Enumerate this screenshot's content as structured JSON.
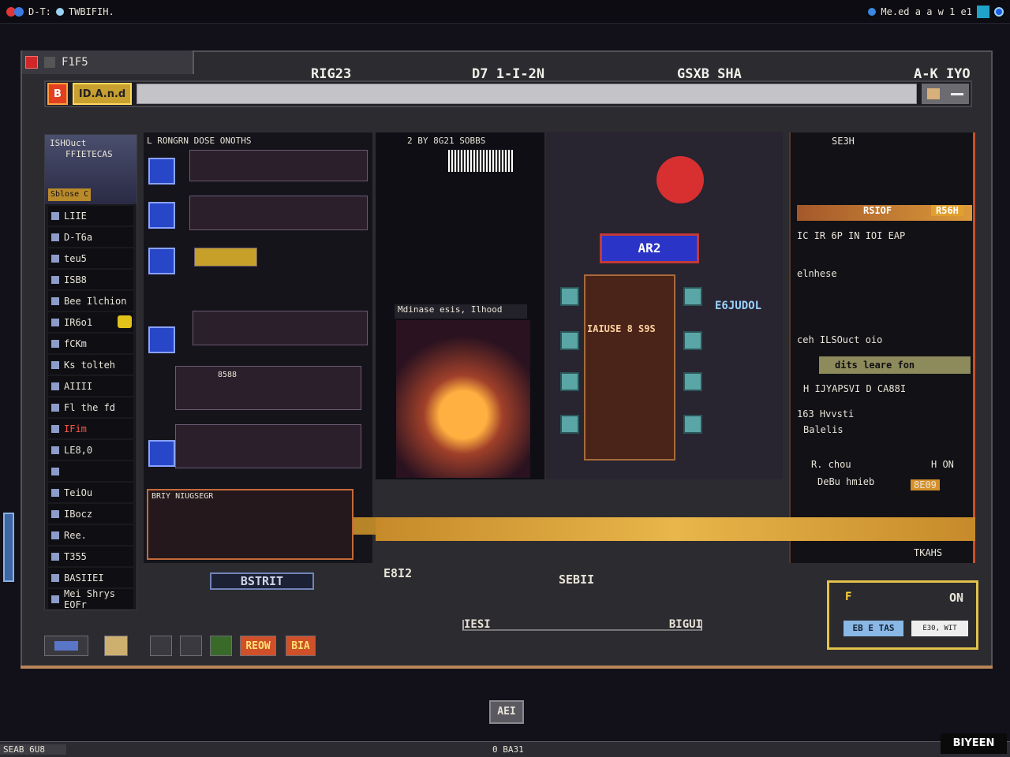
{
  "topbar": {
    "app_label": "D-T: ",
    "app_title": "TWBIFIH.",
    "right_text": "Me.ed  a  a  w  1 e1"
  },
  "window": {
    "tab_title": "F1F5",
    "toolbar": {
      "btn1": "B",
      "btn2": "ID.A.n.d"
    }
  },
  "sidebar": {
    "header_line1": "ISHOuct",
    "header_line2": "FFIETECAS",
    "badge": "Sblose C",
    "items": [
      {
        "label": "LIIE"
      },
      {
        "label": "D-T6a"
      },
      {
        "label": "teu5"
      },
      {
        "label": "ISB8"
      },
      {
        "label": "Bee Ilchion"
      },
      {
        "label": "IR6o1"
      },
      {
        "label": "fCKm"
      },
      {
        "label": "Ks tolteh"
      },
      {
        "label": "AIIII"
      },
      {
        "label": "Fl the fd"
      },
      {
        "label": "IFim"
      },
      {
        "label": "LE8,0"
      },
      {
        "label": ""
      },
      {
        "label": "TeiOu"
      },
      {
        "label": "IBocz"
      },
      {
        "label": "Ree."
      },
      {
        "label": "T355"
      },
      {
        "label": "BASIIEI"
      },
      {
        "label": "Mei Shrys EOFr"
      }
    ]
  },
  "columns": {
    "col1_head": "RIG23",
    "col2_head": "D7 1-I-2N",
    "col3_head": "GSXB SHA",
    "col4_head": "A-K IYO"
  },
  "col1": {
    "title": "L RONGRN DOSE ONOTHS",
    "stage_label": "8588",
    "strip_title": "BRIY NIUGSEGR"
  },
  "col2": {
    "header": "2 BY 8G21 SOBBS",
    "scene_label": "Mdinase esis, Ilhood"
  },
  "col3": {
    "sign": "AR2",
    "shop_label": "IAIUSE 8 S9S",
    "side_label": "E6JUDOL"
  },
  "col4": {
    "top_label": "SE3H",
    "tag_left": "RSIOF",
    "tag_right": "R56H",
    "row1": "IC IR 6P IN IOI  EAP",
    "row2": "elnhese",
    "row3": "ceh ILSOuct oio",
    "btn1": "dits  leare fon",
    "row4": "H IJYAPSVI  D  CA88I",
    "row5": "163 Hvvsti",
    "row6": "Balelis",
    "row7": "R.  chou",
    "row8": "DeBu hmieb",
    "row9": "H ON",
    "tag2": "8E09",
    "footer": "TKAHS"
  },
  "stage_labels": {
    "a": "E8I2",
    "b": "SEBII",
    "c": "BSTRIT",
    "d": "IESI",
    "e": "BIGUI"
  },
  "bottom_bar": {
    "b1": "REOW",
    "b2": "BIA"
  },
  "popup": {
    "title": "F",
    "state": "ON",
    "btn1": "EB E TAS",
    "btn2": "E30, WIT"
  },
  "center_button": "AEI",
  "statusbar": {
    "left": "SEAB 6U8",
    "center": "0 BA31"
  },
  "watermark": "BIYEEN",
  "colors": {
    "accent": "#e2c24a",
    "frame": "#c8502a",
    "sign_blue": "#2a35c8",
    "bg": "#121019"
  }
}
